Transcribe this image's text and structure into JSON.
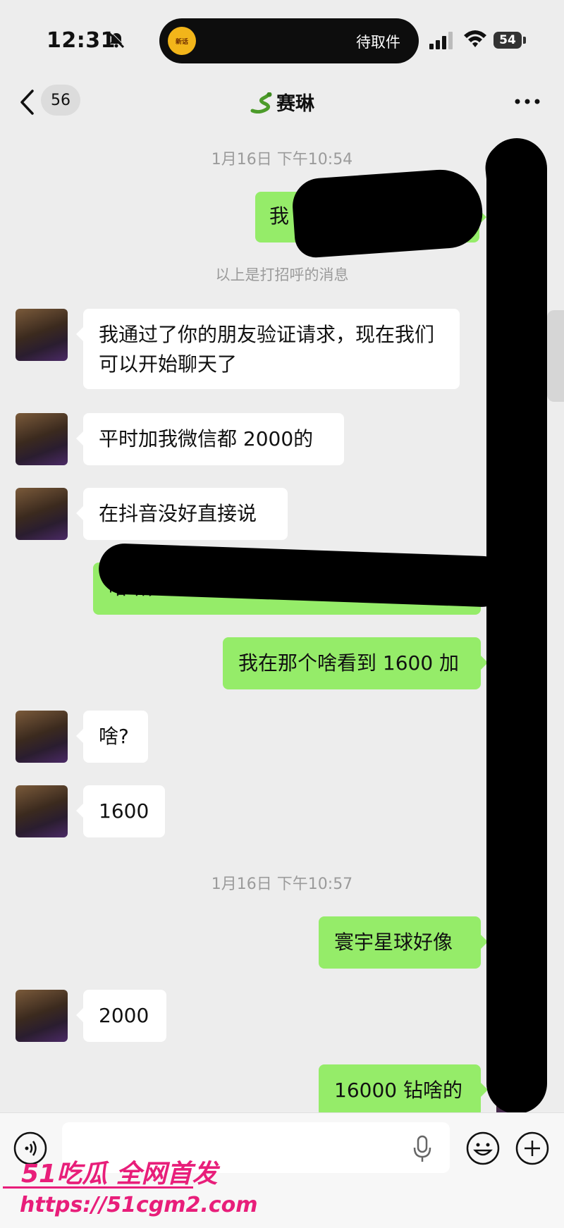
{
  "status_bar": {
    "time": "12:31",
    "island_logo": "新话",
    "island_text": "待取件",
    "battery": "54"
  },
  "nav": {
    "unread_count": "56",
    "contact_name": "赛琳"
  },
  "timestamps": [
    "1月16日 下午10:54",
    "1月16日 下午10:57"
  ],
  "system_note": "以上是打招呼的消息",
  "messages": [
    {
      "side": "out",
      "text": "我",
      "redacted": true
    },
    {
      "side": "in",
      "text": "我通过了你的朋友验证请求，现在我们可以开始聊天了"
    },
    {
      "side": "in",
      "text": "平时加我微信都 2000的"
    },
    {
      "side": "in",
      "text": "在抖音没好直接说"
    },
    {
      "side": "out",
      "text": "哈哈，看来我是上辈子拯救了银河系啊",
      "redacted": true
    },
    {
      "side": "out",
      "text": "我在那个啥看到 1600 加"
    },
    {
      "side": "in",
      "text": "啥?"
    },
    {
      "side": "in",
      "text": "1600"
    },
    {
      "side": "out",
      "text": "寰宇星球好像"
    },
    {
      "side": "in",
      "text": "2000"
    },
    {
      "side": "out",
      "text": "16000 钻啥的"
    }
  ],
  "input": {
    "placeholder": ""
  },
  "watermark": {
    "title": "51吃瓜 全网首发",
    "url": "https://51cgm2.com"
  },
  "colors": {
    "outgoing_bubble": "#95ec69",
    "incoming_bubble": "#ffffff",
    "background": "#ededed",
    "watermark": "#e81e7a"
  }
}
